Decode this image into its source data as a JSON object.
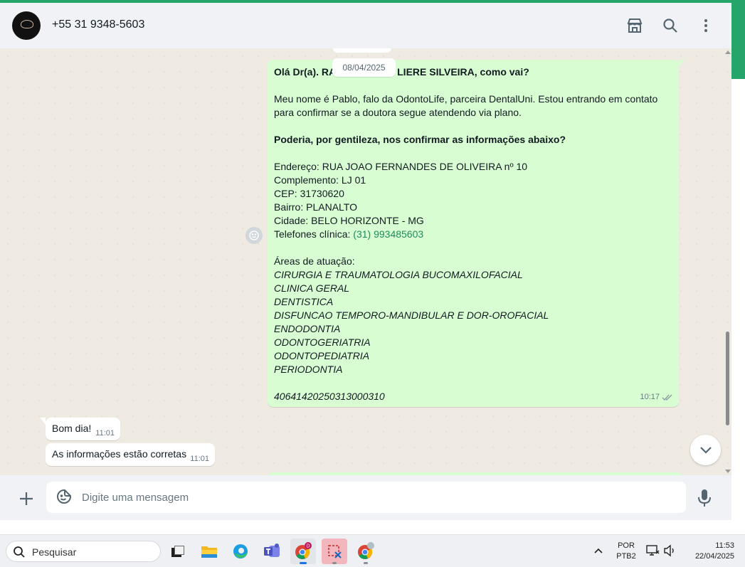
{
  "header": {
    "contact": "+55 31 9348-5603",
    "icons": [
      "catalog-icon",
      "search-icon",
      "menu-icon"
    ]
  },
  "chat": {
    "date_separator": "08/04/2025",
    "outgoing": {
      "line1": "Olá Dr(a). RA",
      "line1_end": "LIERE SILVEIRA, como vai?",
      "intro1": "Meu nome é Pablo, falo da OdontoLife, parceira DentalUni. Estou entrando em contato",
      "intro2": "para confirmar se a doutora segue atendendo via plano.",
      "request": "Poderia, por gentileza, nos confirmar as informações abaixo?",
      "endereco": "Endereço: RUA JOAO FERNANDES DE OLIVEIRA nº 10",
      "complemento": "Complemento: LJ 01",
      "cep": "CEP: 31730620",
      "bairro": "Bairro: PLANALTO",
      "cidade": "Cidade: BELO HORIZONTE - MG",
      "telefones_label": "Telefones clínica: ",
      "telefones_link": "(31) 993485603",
      "areas_title": "Áreas de atuação:",
      "areas": [
        "CIRURGIA E TRAUMATOLOGIA BUCOMAXILOFACIAL",
        "CLINICA GERAL",
        "DENTISTICA",
        "DISFUNCAO TEMPORO-MANDIBULAR E DOR-OROFACIAL",
        "ENDODONTIA",
        "ODONTOGERIATRIA",
        "ODONTOPEDIATRIA",
        "PERIODONTIA"
      ],
      "code": "40641420250313000310",
      "time": "10:17"
    },
    "incoming": [
      {
        "text": "Bom dia!",
        "time": "11:01"
      },
      {
        "text": "As informações estão corretas",
        "time": "11:01"
      }
    ]
  },
  "composer": {
    "placeholder": "Digite uma mensagem"
  },
  "taskbar": {
    "search_label": "Pesquisar",
    "lang_line1": "POR",
    "lang_line2": "PTB2",
    "time": "11:53",
    "date": "22/04/2025"
  },
  "colors": {
    "accent": "#25a56a",
    "outgoing_bubble": "#d9fdd3",
    "incoming_bubble": "#ffffff",
    "chat_bg": "#efeae2",
    "link": "#1f8a5e"
  }
}
